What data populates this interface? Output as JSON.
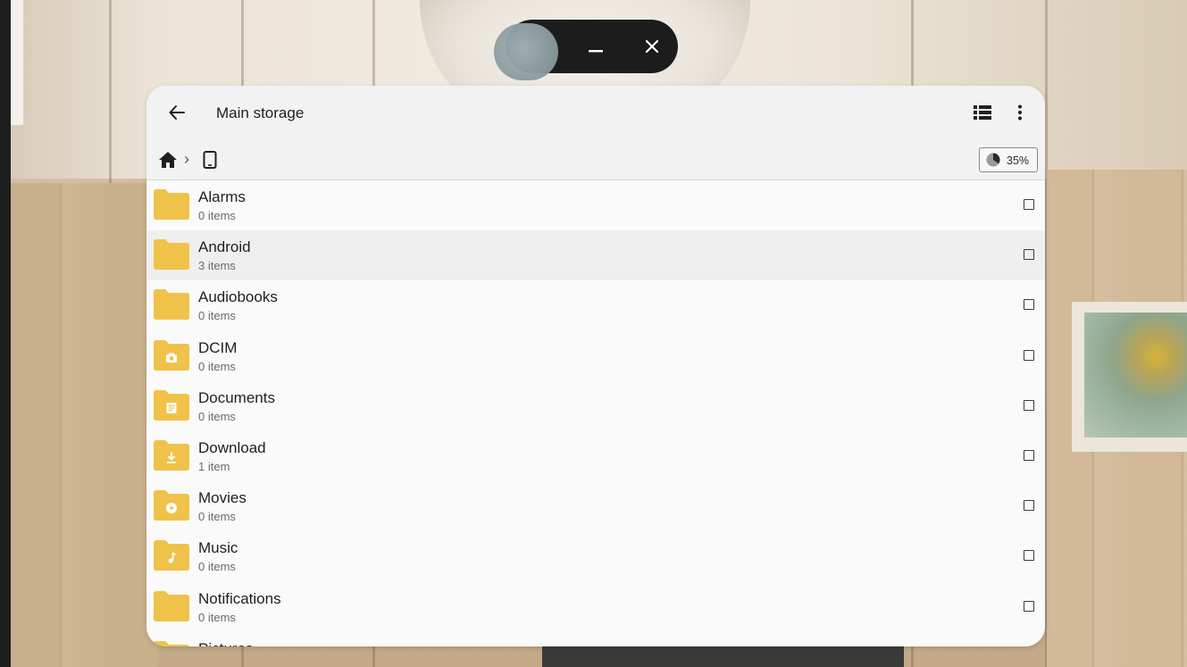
{
  "toolbar": {
    "title": "Main storage"
  },
  "breadcrumb": {
    "separator": "›"
  },
  "storage": {
    "usage_label": "35%",
    "usage_fraction": 0.35
  },
  "folders": [
    {
      "name": "Alarms",
      "count": "0 items",
      "icon": "folder-icon"
    },
    {
      "name": "Android",
      "count": "3 items",
      "icon": "folder-icon"
    },
    {
      "name": "Audiobooks",
      "count": "0 items",
      "icon": "folder-icon"
    },
    {
      "name": "DCIM",
      "count": "0 items",
      "icon": "camera-folder-icon"
    },
    {
      "name": "Documents",
      "count": "0 items",
      "icon": "document-folder-icon"
    },
    {
      "name": "Download",
      "count": "1 item",
      "icon": "download-folder-icon"
    },
    {
      "name": "Movies",
      "count": "0 items",
      "icon": "movie-folder-icon"
    },
    {
      "name": "Music",
      "count": "0 items",
      "icon": "music-folder-icon"
    },
    {
      "name": "Notifications",
      "count": "0 items",
      "icon": "folder-icon"
    },
    {
      "name": "Pictures",
      "count": "",
      "icon": "folder-icon"
    }
  ],
  "colors": {
    "folder": "#f1c24a",
    "folder_glyph": "#ffffff"
  }
}
